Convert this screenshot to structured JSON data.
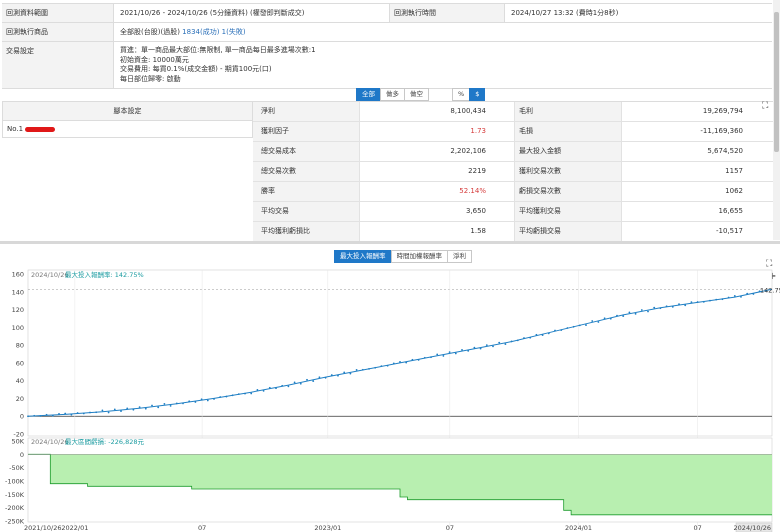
{
  "info": {
    "rows": [
      {
        "label": "回測資料範圍",
        "value": "2021/10/26 - 2024/10/26 (5分鐘資料) (權發即判斷成交)",
        "label2": "回測執行時間",
        "value2": "2024/10/27 13:32 (費時1分8秒)"
      },
      {
        "label": "回測執行商品",
        "value_prefix": "全部股(台股)(過股)",
        "value_link": "1834(成功) 1(失敗)"
      },
      {
        "label": "交易設定",
        "lines": [
          "買進：單一商品最大部位:無限制, 單一商品每日最多進場次數:1",
          "初始資金: 10000萬元",
          "交易費用: 每買0.1%(成交金額) - 期貨100元(口)",
          "每日部位歸零: 啟動"
        ]
      }
    ]
  },
  "side_toggle": {
    "items": [
      "全部",
      "做多",
      "做空"
    ],
    "active": 0
  },
  "unit_toggle": {
    "items": [
      "%",
      "$"
    ],
    "active": 1
  },
  "script": {
    "header": "腳本設定",
    "row_label": "No.1"
  },
  "stats": [
    {
      "l1": "淨利",
      "v1": "8,100,434",
      "l2": "毛利",
      "v2": "19,269,794",
      "red": false
    },
    {
      "l1": "獲利因子",
      "v1": "1.73",
      "l2": "毛損",
      "v2": "-11,169,360",
      "red": true
    },
    {
      "l1": "總交易成本",
      "v1": "2,202,106",
      "l2": "最大投入金額",
      "v2": "5,674,520",
      "red": false
    },
    {
      "l1": "總交易次數",
      "v1": "2219",
      "l2": "獲利交易次數",
      "v2": "1157",
      "red": false
    },
    {
      "l1": "勝率",
      "v1": "52.14%",
      "l2": "虧損交易次數",
      "v2": "1062",
      "red": true
    },
    {
      "l1": "平均交易",
      "v1": "3,650",
      "l2": "平均獲利交易",
      "v2": "16,655",
      "red": false
    },
    {
      "l1": "平均獲利虧損比",
      "v1": "1.58",
      "l2": "平均虧損交易",
      "v2": "-10,517",
      "red": false
    }
  ],
  "chart_tabs": {
    "items": [
      "最大投入報酬率",
      "時間加權報酬率",
      "淨利"
    ],
    "active": 0
  },
  "icons": {
    "expand": "expand-icon",
    "plus": "plus-icon",
    "expand2": "expand-icon"
  },
  "colors": {
    "accent": "#1f78c8",
    "line": "#1f7fc4",
    "teal_text": "#1a9ba0",
    "drawdown_fill": "#b8efb0",
    "drawdown_line": "#1c9c2c",
    "red": "#d63c3c"
  },
  "chart_data": [
    {
      "type": "line",
      "legend_date": "2024/10/26",
      "legend_label": "最大投入報酬率: 142.75%",
      "last_value_label": "142.75",
      "ylim": [
        -20,
        160
      ],
      "yticks": [
        -20,
        0,
        20,
        40,
        60,
        80,
        100,
        120,
        140,
        160
      ],
      "reference_line": 142.75,
      "series": [
        {
          "x": [
            0,
            0.05,
            0.1,
            0.15,
            0.2,
            0.25,
            0.3,
            0.35,
            0.4,
            0.45,
            0.5,
            0.55,
            0.6,
            0.65,
            0.7,
            0.75,
            0.8,
            0.85,
            0.9,
            0.95,
            1.0
          ],
          "values": [
            0,
            2,
            5,
            9,
            14,
            20,
            27,
            35,
            44,
            52,
            60,
            68,
            76,
            84,
            94,
            104,
            114,
            122,
            128,
            134,
            142.75
          ]
        }
      ]
    },
    {
      "type": "area",
      "legend_date": "2024/10/26",
      "legend_label": "最大區間虧損: -226,828元",
      "ylim": [
        -250000,
        50000
      ],
      "ytick_labels": [
        "50K",
        "0",
        "-50K",
        "-100K",
        "-150K",
        "-200K",
        "-250K"
      ],
      "yticks": [
        50000,
        0,
        -50000,
        -100000,
        -150000,
        -200000,
        -250000
      ],
      "series": [
        {
          "x": [
            0,
            0.03,
            0.08,
            0.22,
            0.5,
            0.51,
            0.72,
            0.73,
            1.0
          ],
          "values": [
            0,
            -110000,
            -120000,
            -130000,
            -160000,
            -170000,
            -210000,
            -226828,
            -226828
          ]
        }
      ]
    }
  ],
  "x_axis": {
    "labels": [
      "2021/10/26",
      "2022/01",
      "07",
      "2023/01",
      "07",
      "2024/01",
      "07",
      "2024/10/26"
    ]
  }
}
